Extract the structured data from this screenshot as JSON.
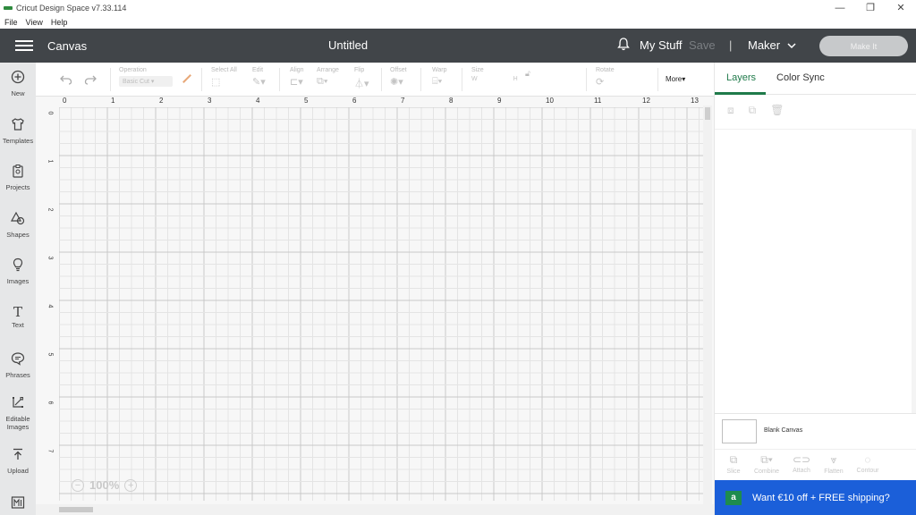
{
  "window": {
    "title": "Cricut Design Space  v7.33.114",
    "minimize": "—",
    "maximize": "❐",
    "close": "✕"
  },
  "menu": [
    "File",
    "View",
    "Help"
  ],
  "appbar": {
    "section": "Canvas",
    "doc_title": "Untitled",
    "my_stuff": "My Stuff",
    "save": "Save",
    "divider": "|",
    "machine": "Maker",
    "machine_chevron": "⌄",
    "make_it": "Make It"
  },
  "sidebar": [
    {
      "label": "New",
      "icon": "plus-circle-icon",
      "glyph": "⊕"
    },
    {
      "label": "Templates",
      "icon": "shirt-icon",
      "glyph": "👕"
    },
    {
      "label": "Projects",
      "icon": "clipboard-icon",
      "glyph": "📋"
    },
    {
      "label": "Shapes",
      "icon": "shapes-icon",
      "glyph": "△"
    },
    {
      "label": "Images",
      "icon": "bulb-icon",
      "glyph": "💡"
    },
    {
      "label": "Text",
      "icon": "text-icon",
      "glyph": "T"
    },
    {
      "label": "Phrases",
      "icon": "speech-icon",
      "glyph": "💬"
    },
    {
      "label": "Editable Images",
      "icon": "editable-icon",
      "glyph": "⤧"
    },
    {
      "label": "Upload",
      "icon": "upload-icon",
      "glyph": "⤒"
    },
    {
      "label": "",
      "icon": "barcode-icon",
      "glyph": "▥"
    }
  ],
  "toolbar": {
    "operation_label": "Operation",
    "operation_value": "Basic Cut",
    "select_all": "Select All",
    "edit": "Edit",
    "align": "Align",
    "arrange": "Arrange",
    "flip": "Flip",
    "offset": "Offset",
    "warp": "Warp",
    "size": "Size",
    "size_w": "W",
    "size_h": "H",
    "rotate": "Rotate",
    "more": "More▾"
  },
  "canvas": {
    "ruler_top": [
      "0",
      "1",
      "2",
      "3",
      "4",
      "5",
      "6",
      "7",
      "8",
      "9",
      "10",
      "11",
      "12",
      "13"
    ],
    "ruler_left": [
      "0",
      "1",
      "2",
      "3",
      "4",
      "5",
      "6",
      "7"
    ],
    "zoom": "100%",
    "zoom_out": "−",
    "zoom_in": "+"
  },
  "right_panel": {
    "tabs": [
      "Layers",
      "Color Sync"
    ],
    "blank_canvas": "Blank Canvas",
    "bottom_tools": [
      "Slice",
      "Combine",
      "Attach",
      "Flatten",
      "Contour"
    ],
    "promo": "Want €10 off + FREE shipping?",
    "promo_badge": "a"
  },
  "colors": {
    "appbar": "#414549",
    "accent_green": "#1f7a4a",
    "promo_blue": "#1b5fd9"
  }
}
